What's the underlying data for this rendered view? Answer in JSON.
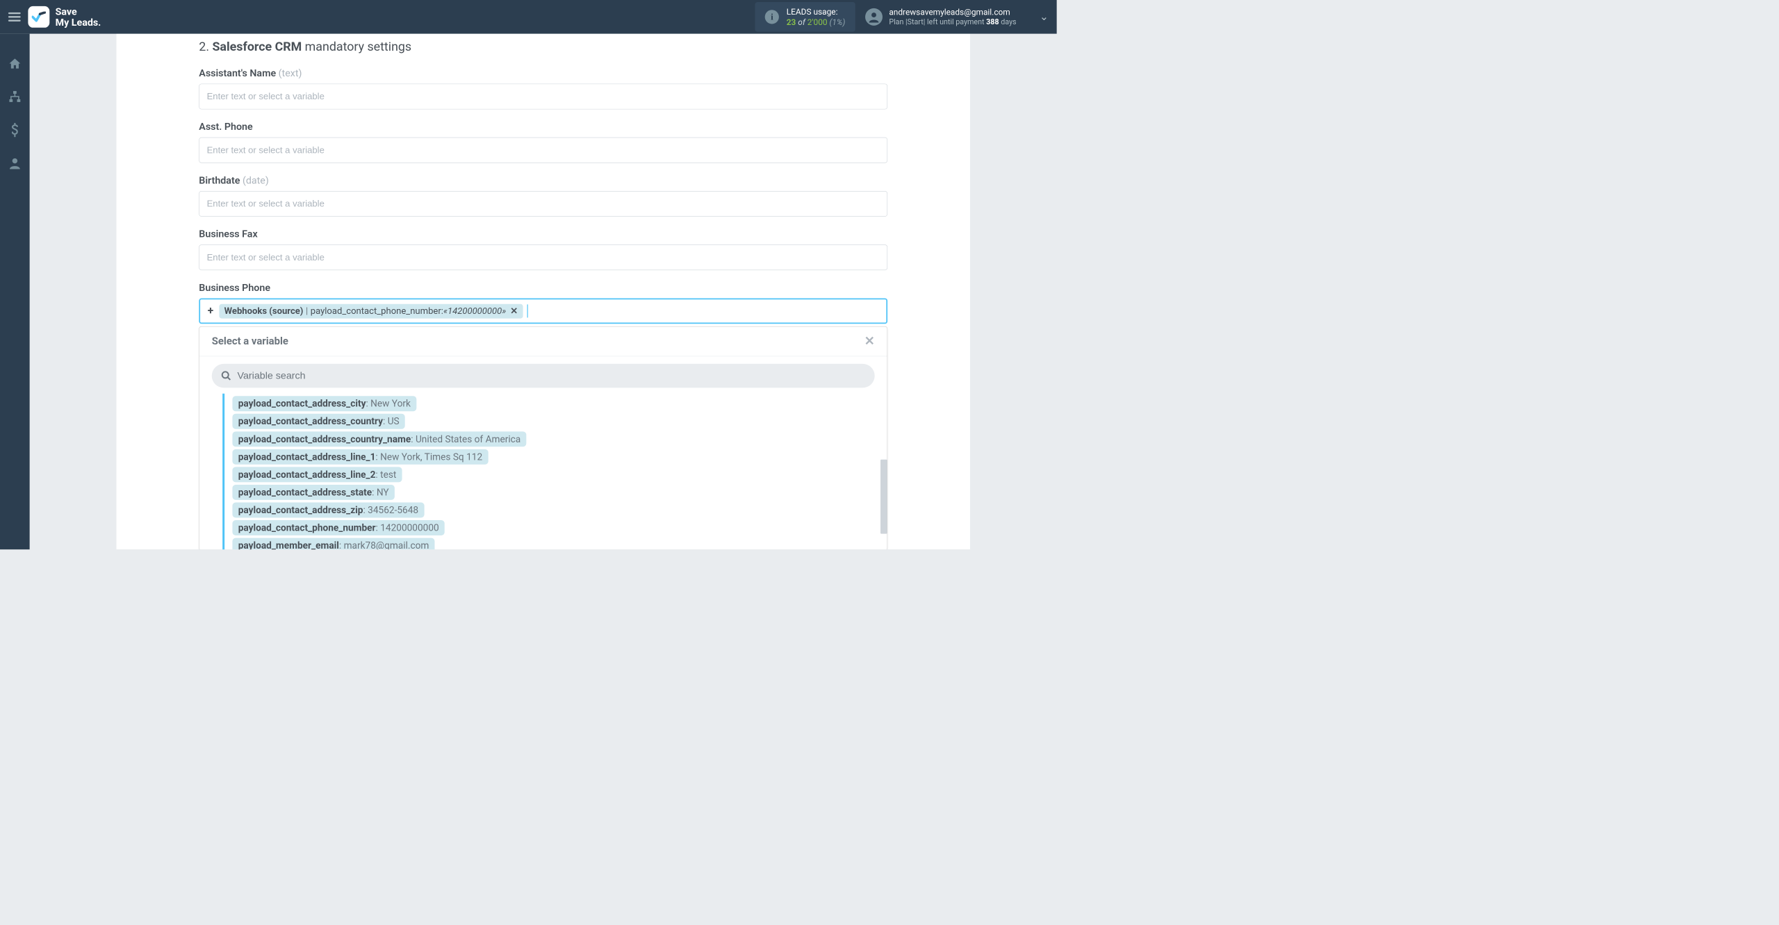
{
  "header": {
    "brand_line1": "Save",
    "brand_line2": "My Leads.",
    "usage_label": "LEADS usage:",
    "usage_used": "23",
    "usage_of": " of ",
    "usage_total": "2'000",
    "usage_pct": " (1%)",
    "user_email": "andrewsavemyleads@gmail.com",
    "plan_prefix": "Plan |Start| left until payment ",
    "plan_days": "388",
    "plan_suffix": " days"
  },
  "section": {
    "number": "2. ",
    "bold": "Salesforce CRM",
    "rest": " mandatory settings"
  },
  "fields": [
    {
      "label": "Assistant's Name",
      "hint": " (text)",
      "placeholder": "Enter text or select a variable"
    },
    {
      "label": "Asst. Phone",
      "hint": "",
      "placeholder": "Enter text or select a variable"
    },
    {
      "label": "Birthdate",
      "hint": " (date)",
      "placeholder": "Enter text or select a variable"
    },
    {
      "label": "Business Fax",
      "hint": "",
      "placeholder": "Enter text or select a variable"
    }
  ],
  "active_field": {
    "label": "Business Phone",
    "chip_source": "Webhooks (source)",
    "chip_sep": " | ",
    "chip_key": "payload_contact_phone_number: ",
    "chip_val": "«14200000000»",
    "chip_x": " ✕"
  },
  "dropdown": {
    "title": "Select a variable",
    "search_placeholder": "Variable search",
    "variables": [
      {
        "key": "payload_contact_address_city",
        "val": ": New York"
      },
      {
        "key": "payload_contact_address_country",
        "val": ": US"
      },
      {
        "key": "payload_contact_address_country_name",
        "val": ": United States of America"
      },
      {
        "key": "payload_contact_address_line_1",
        "val": ": New York, Times Sq 112"
      },
      {
        "key": "payload_contact_address_line_2",
        "val": ": test"
      },
      {
        "key": "payload_contact_address_state",
        "val": ": NY"
      },
      {
        "key": "payload_contact_address_zip",
        "val": ": 34562-5648"
      },
      {
        "key": "payload_contact_phone_number",
        "val": ": 14200000000"
      },
      {
        "key": "payload_member_email",
        "val": ": mark78@gmail.com"
      }
    ]
  }
}
